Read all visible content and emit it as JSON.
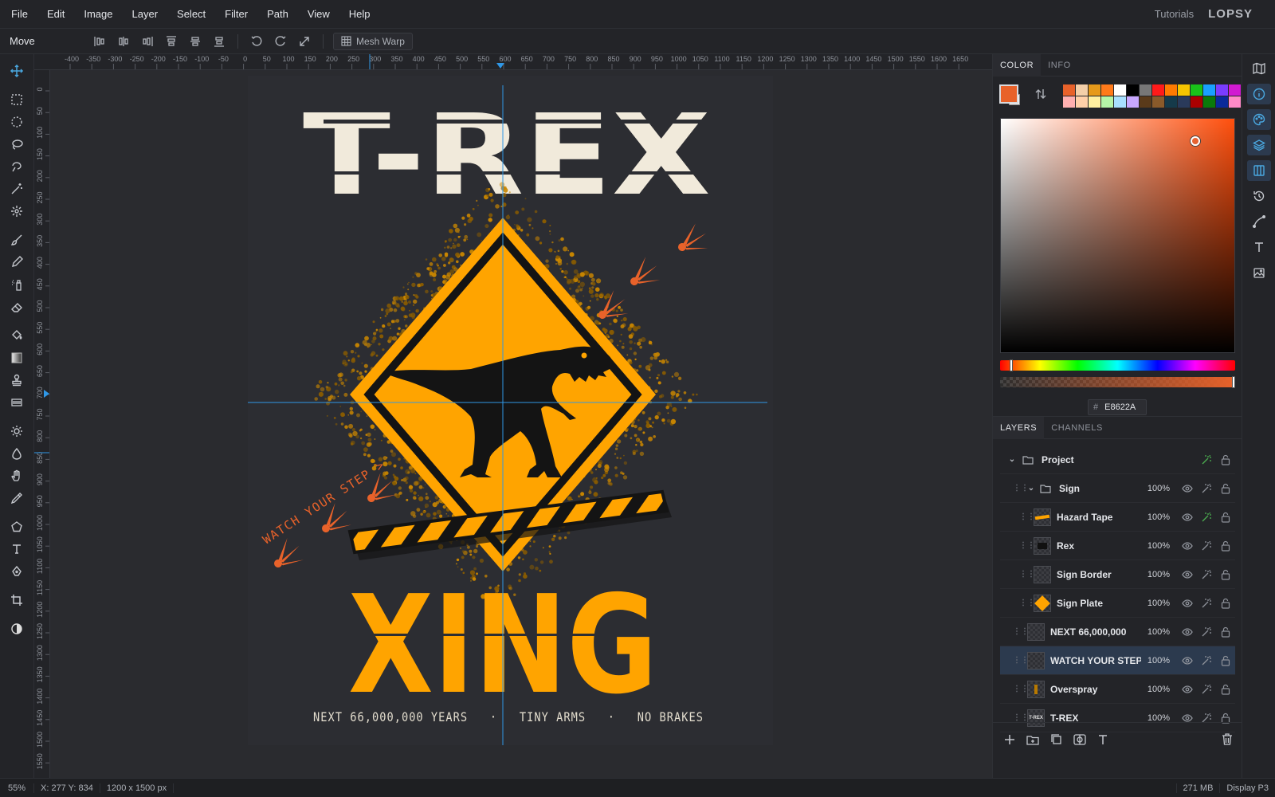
{
  "menu": [
    "File",
    "Edit",
    "Image",
    "Layer",
    "Select",
    "Filter",
    "Path",
    "View",
    "Help"
  ],
  "header": {
    "tutorials": "Tutorials",
    "logo": "LOPSY"
  },
  "options": {
    "tool_name": "Move",
    "mesh_warp": "Mesh Warp"
  },
  "ruler": {
    "top": [
      "-400",
      "-350",
      "-300",
      "-250",
      "-200",
      "-150",
      "-100",
      "-50",
      "0",
      "50",
      "100",
      "150",
      "200",
      "250",
      "300",
      "350",
      "400",
      "450",
      "500",
      "550",
      "600",
      "650",
      "700",
      "750",
      "800",
      "850",
      "900",
      "950",
      "1000",
      "1050",
      "1100",
      "1150",
      "1200",
      "1250",
      "1300",
      "1350",
      "1400",
      "1450",
      "1500",
      "1550",
      "1600",
      "1650"
    ],
    "left": [
      "0",
      "50",
      "100",
      "150",
      "200",
      "250",
      "300",
      "350",
      "400",
      "450",
      "500",
      "550",
      "600",
      "650",
      "700",
      "750",
      "800",
      "850",
      "900",
      "950",
      "1000",
      "1050",
      "1100",
      "1150",
      "1200",
      "1250",
      "1300",
      "1350",
      "1400",
      "1450",
      "1500",
      "1550"
    ]
  },
  "artwork": {
    "title": "T-REX",
    "xing": "XING",
    "watch": "WATCH YOUR STEP >",
    "tagline": "NEXT 66,000,000 YEARS   ·   TINY ARMS   ·   NO BRAKES",
    "colors": {
      "cream": "#f1eadb",
      "amber": "#ffa400",
      "rust": "#e8622a",
      "ink": "#141414",
      "background": "#2c2d32"
    }
  },
  "color_panel": {
    "tabs": [
      "COLOR",
      "INFO"
    ],
    "hex": "E8622A",
    "foreground": "#e8622a",
    "background": "#f4f4f4",
    "palette_row1": [
      "#e8622a",
      "#f3cfa8",
      "#e69a1b",
      "#ff7a1a",
      "#ffffff",
      "#000000",
      "#777777",
      "#ff1a1a",
      "#ff7a00",
      "#f5c400",
      "#19c219",
      "#19a0ff",
      "#7a3cff",
      "#d11ad1"
    ],
    "palette_row2": [
      "#ffb0b0",
      "#ffd0a8",
      "#fff0a0",
      "#b6f5a8",
      "#a8e0ff",
      "#c8a8ff",
      "#5a3a1a",
      "#8a5a2a",
      "#153a4a",
      "#2a3a5a",
      "#aa0000",
      "#0a7a0a",
      "#0a2a9a",
      "#ff8ac8"
    ]
  },
  "layers_panel": {
    "tabs": [
      "LAYERS",
      "CHANNELS"
    ],
    "layers": [
      {
        "name": "Project",
        "opacity": "",
        "type": "group-root"
      },
      {
        "name": "Sign",
        "opacity": "100%",
        "type": "group"
      },
      {
        "name": "Hazard Tape",
        "opacity": "100%",
        "type": "child"
      },
      {
        "name": "Rex",
        "opacity": "100%",
        "type": "child"
      },
      {
        "name": "Sign Border",
        "opacity": "100%",
        "type": "child"
      },
      {
        "name": "Sign Plate",
        "opacity": "100%",
        "type": "child"
      },
      {
        "name": "NEXT 66,000,000",
        "opacity": "100%",
        "type": "layer"
      },
      {
        "name": "WATCH YOUR STEP",
        "opacity": "100%",
        "type": "layer",
        "selected": true
      },
      {
        "name": "Overspray",
        "opacity": "100%",
        "type": "layer"
      },
      {
        "name": "T-REX",
        "opacity": "100%",
        "type": "layer",
        "thumb_text": "T-REX"
      }
    ]
  },
  "status": {
    "zoom": "55%",
    "coords": "X: 277 Y: 834",
    "size": "1200 x 1500",
    "size_unit": "px",
    "memory": "271 MB",
    "display": "Display P3"
  }
}
